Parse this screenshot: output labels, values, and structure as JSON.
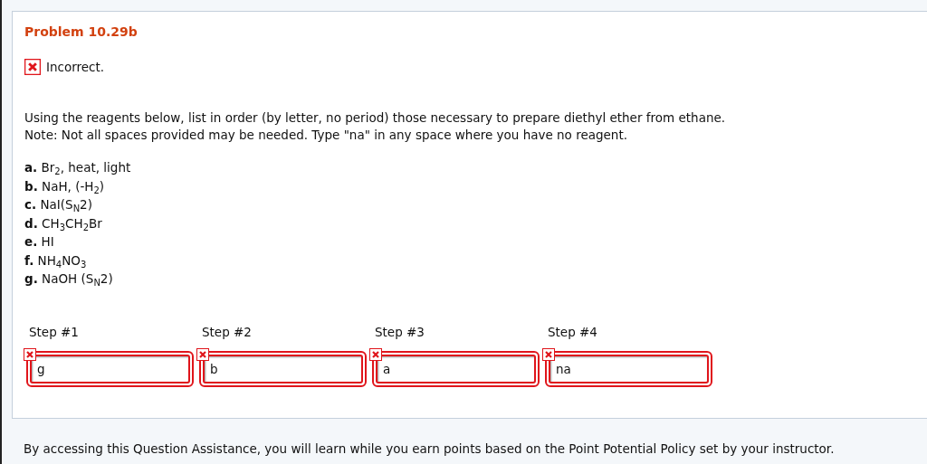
{
  "problem": {
    "title": "Problem 10.29b",
    "status": {
      "correct": false,
      "text": "Incorrect."
    },
    "instructions": [
      "Using the reagents below, list in order (by letter, no period) those necessary to prepare diethyl ether from ethane.",
      "Note: Not all spaces provided may be needed. Type \"na\" in any space where you have no reagent."
    ],
    "options": [
      "**a.** Br$_{2}$, heat, light",
      "**b.** NaH, (-H$_{2}$)",
      "**c.** NaI(S$_{N}$2)",
      "**d.** CH$_{3}$CH$_{2}$Br",
      "**e.** HI",
      "**f.** NH$_{4}$NO$_{3}$",
      "**g.** NaOH (S$_{N}$2)"
    ],
    "steps": [
      {
        "label": "Step #1",
        "value": "g",
        "correct": false
      },
      {
        "label": "Step #2",
        "value": "b",
        "correct": false
      },
      {
        "label": "Step #3",
        "value": "a",
        "correct": false
      },
      {
        "label": "Step #4",
        "value": "na",
        "correct": false
      }
    ]
  },
  "footer": "By accessing this Question Assistance, you will learn while you earn points based on the Point Potential Policy set by your instructor."
}
